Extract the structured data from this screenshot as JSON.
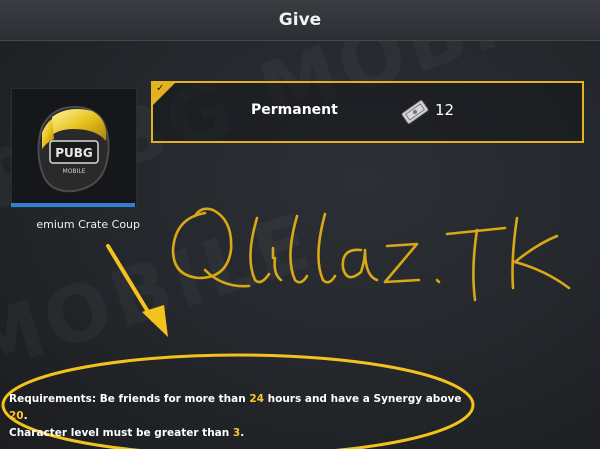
{
  "header": {
    "title": "Give"
  },
  "item": {
    "name": "emium Crate Coup"
  },
  "option": {
    "label": "Permanent",
    "cost": "12",
    "icon": "coupon-ticket-icon",
    "selected": true
  },
  "annotation": {
    "signature_text": "Qillaz.Tk"
  },
  "requirements": {
    "line1_a": "Requirements: Be friends for more than ",
    "hours": "24",
    "line1_b": " hours and have a Synergy above ",
    "synergy": "20",
    "line1_c": ".",
    "line2_a": " Character level must be greater than ",
    "level": "3",
    "line2_b": "."
  },
  "colors": {
    "accent": "#e3b21e",
    "highlight": "#ffc629",
    "item_bar": "#2f7fd6"
  }
}
